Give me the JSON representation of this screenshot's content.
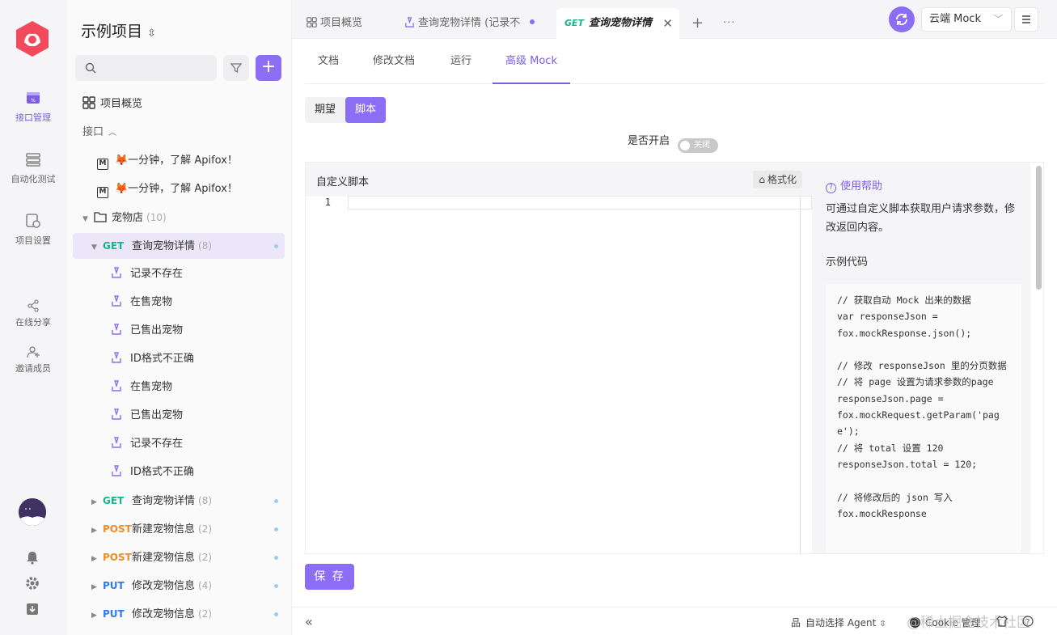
{
  "rail": {
    "items": [
      {
        "label": "接口管理",
        "icon": "api-management-icon",
        "active": true
      },
      {
        "label": "自动化测试",
        "icon": "automation-test-icon",
        "active": false
      },
      {
        "label": "项目设置",
        "icon": "project-settings-icon",
        "active": false
      },
      {
        "label": "在线分享",
        "icon": "share-icon",
        "active": false
      },
      {
        "label": "邀请成员",
        "icon": "invite-member-icon",
        "active": false
      }
    ]
  },
  "sidebar": {
    "project_name": "示例项目",
    "overview": "项目概览",
    "interface_group": "接口",
    "docs": [
      "🦊一分钟，了解 Apifox！",
      "🦊一分钟，了解 Apifox！"
    ],
    "folder": {
      "name": "宠物店",
      "count": "(10)"
    },
    "selected_api": {
      "method": "GET",
      "name": "查询宠物详情",
      "count": "(8)"
    },
    "cases": [
      "记录不存在",
      "在售宠物",
      "已售出宠物",
      "ID格式不正确",
      "在售宠物",
      "已售出宠物",
      "记录不存在",
      "ID格式不正确"
    ],
    "apis": [
      {
        "method": "GET",
        "name": "查询宠物详情",
        "count": "(8)"
      },
      {
        "method": "POST",
        "name": "新建宠物信息",
        "count": "(2)"
      },
      {
        "method": "POST",
        "name": "新建宠物信息",
        "count": "(2)"
      },
      {
        "method": "PUT",
        "name": "修改宠物信息",
        "count": "(4)"
      },
      {
        "method": "PUT",
        "name": "修改宠物信息",
        "count": "(2)"
      }
    ]
  },
  "tabs": {
    "items": [
      {
        "label": "项目概览"
      },
      {
        "label": "查询宠物详情 (记录不"
      },
      {
        "method": "GET",
        "label": "查询宠物详情"
      }
    ],
    "environment": "云端 Mock"
  },
  "subtabs": [
    "文档",
    "修改文档",
    "运行",
    "高级 Mock"
  ],
  "segment": [
    "期望",
    "脚本"
  ],
  "switch": {
    "label": "是否开启",
    "state": "关闭"
  },
  "editor": {
    "title": "自定义脚本",
    "format_label": "格式化",
    "line_number": "1"
  },
  "help": {
    "title": "使用帮助",
    "description": "可通过自定义脚本获取用户请求参数，修改返回内容。",
    "example_label": "示例代码",
    "code": "// 获取自动 Mock 出来的数据\nvar responseJson =\nfox.mockResponse.json();\n\n// 修改 responseJson 里的分页数据\n// 将 page 设置为请求参数的page\nresponseJson.page =\nfox.mockRequest.getParam('page');\n// 将 total 设置 120\nresponseJson.total = 120;\n\n// 将修改后的 json 写入\nfox.mockResponse"
  },
  "save_label": "保 存",
  "footer": {
    "agent": "自动选择 Agent",
    "cookie": "Cookie 管理",
    "watermark": "@稀土掘金技术社区"
  },
  "colors": {
    "accent": "#8c6df5",
    "get": "#18b48b",
    "post": "#f08a24",
    "put": "#2b7cf0"
  }
}
